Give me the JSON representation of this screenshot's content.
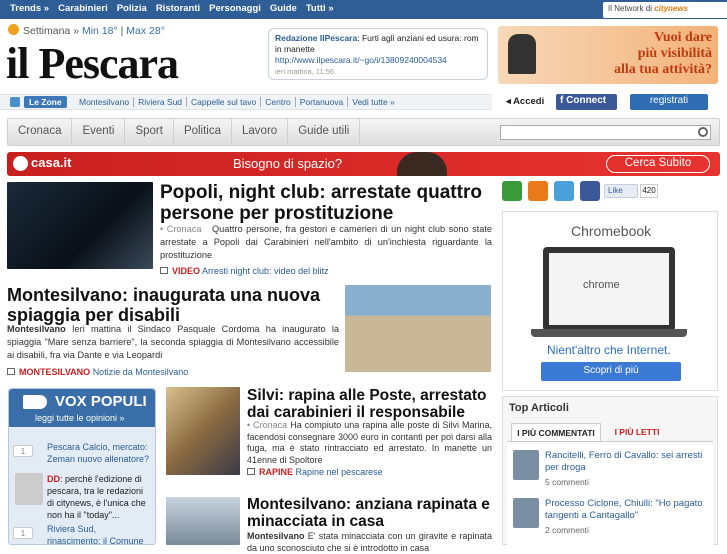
{
  "topbar": {
    "items": [
      "Trends »",
      "Carabinieri",
      "Polizia",
      "Ristoranti",
      "Personaggi",
      "Guide",
      "Tutti »"
    ],
    "network_label": "Il Network di",
    "network_brand": "citynews"
  },
  "weather": {
    "label": "Settimana »",
    "min": "Min 18°",
    "sep": "|",
    "max": "Max 28°"
  },
  "logo": "il Pescara",
  "tweet": {
    "author": "Redazione IlPescara",
    "text": ": Furti agli anziani ed usura: rom in manette",
    "url": "http://www.ilpescara.it/~go/i/13809240004534",
    "time": "ieri mattina, 11:56"
  },
  "promo": {
    "text1": "Vuoi dare",
    "text2": "più visibilità",
    "text3": "alla tua attività?"
  },
  "zones": {
    "label": "Le Zone",
    "items": [
      "Montesilvano",
      "Riviera Sud",
      "Cappelle sul tavo",
      "Centro",
      "Portanuova",
      "Vedi tutte »"
    ]
  },
  "auth": {
    "login": "Accedi",
    "facebook": "Connect",
    "register": "registrati"
  },
  "nav": {
    "items": [
      "Cronaca",
      "Eventi",
      "Sport",
      "Politica",
      "Lavoro",
      "Guide utili"
    ]
  },
  "casa_banner": {
    "brand": "casa.it",
    "headline": "Bisogno di spazio?",
    "cta": "Cerca Subito"
  },
  "articles": [
    {
      "title": "Popoli, night club: arrestate quattro persone per prostituzione",
      "section": "• Cronaca",
      "body": "Quattro persone, fra gestori e camerieri di un night club sono state arrestate a Popoli dai Carabinieri nell'ambito di un'inchiesta riguardante la prostituzione",
      "tag_key": "VIDEO",
      "tag_val": "Arresti night club: video del blitz"
    },
    {
      "title": "Montesilvano: inaugurata una nuova spiaggia per disabili",
      "section": "Montesilvano",
      "body": "Ieri mattina il Sindaco Pasquale Cordoma ha inaugurato la spiaggia \"Mare senza barriere\", la seconda spiaggia di Montesilvano accessibile ai disabili, fra via Dante e via Leopardi",
      "tag_key": "MONTESILVANO",
      "tag_val": "Notizie da Montesilvano"
    },
    {
      "title": "Silvi: rapina alle Poste, arrestato dai carabinieri il responsabile",
      "section": "• Cronaca",
      "body": "Ha compiuto una rapina alle poste di Silvi Marina, facendosi consegnare 3000 euro in contanti per poi darsi alla fuga, ma è stato rintracciato ed arrestato. In manette un 41enne di Spoltore",
      "tag_key": "RAPINE",
      "tag_val": "Rapine nel pescarese"
    },
    {
      "title": "Montesilvano: anziana rapinata e minacciata in casa",
      "section": "Montesilvano",
      "body": "E' stata minacciata con un giravite e rapinata da uno sconosciuto che si è introdotto in casa"
    }
  ],
  "vox": {
    "title": "VOX POPULI",
    "subtitle": "leggi tutte le opinioni »",
    "items": [
      {
        "num": "1",
        "text": "Pescara Calcio, mercato: Zeman nuovo allenatore?"
      },
      {
        "dd": "DD",
        "text": ": perchè l'edizione di pescara, tra le redazioni di citynews, è l'unica che non ha il \"today\"..."
      },
      {
        "num": "1",
        "text": "Riviera Sud, rinascimento: il Comune"
      }
    ]
  },
  "social": {
    "like": "Like",
    "count": "420",
    "colors": [
      "#3a9a3a",
      "#e87a1a",
      "#4aa0d8",
      "#3b5998"
    ]
  },
  "chrome_ad": {
    "title": "Chromebook",
    "logo": "chrome",
    "tagline": "Nient'altro che Internet.",
    "button": "Scopri di più"
  },
  "top_articles": {
    "title": "Top Articoli",
    "tab1": "I PIÙ COMMENTATI",
    "tab2": "I PIÙ LETTI",
    "items": [
      {
        "title": "Rancitelli, Ferro di Cavallo: sei arresti per droga",
        "comments": "5 commenti"
      },
      {
        "title": "Processo Ciclone, Chiulli: \"Ho pagato tangenti a Cantagallo\"",
        "comments": "2 commenti"
      }
    ]
  }
}
